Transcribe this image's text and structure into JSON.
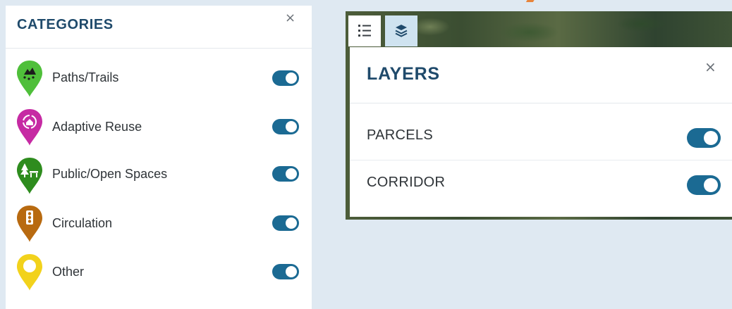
{
  "colors": {
    "accent": "#1f4a6b",
    "toggle_on": "#1b6a93",
    "background": "#dfe9f2",
    "pin_paths": "#4fbf3a",
    "pin_adaptive": "#c62aa3",
    "pin_public": "#2e8c1e",
    "pin_circulation": "#b86a10",
    "pin_other": "#f2d21c"
  },
  "categories": {
    "title": "CATEGORIES",
    "close_label": "×",
    "items": [
      {
        "label": "Paths/Trails",
        "icon": "hiking-trail-icon",
        "on": true
      },
      {
        "label": "Adaptive Reuse",
        "icon": "recycle-house-icon",
        "on": true
      },
      {
        "label": "Public/Open Spaces",
        "icon": "park-bench-tree-icon",
        "on": true
      },
      {
        "label": "Circulation",
        "icon": "traffic-light-icon",
        "on": true
      },
      {
        "label": "Other",
        "icon": "ring-icon",
        "on": true
      }
    ]
  },
  "map_tabs": [
    {
      "icon": "list-icon",
      "active": false
    },
    {
      "icon": "layers-icon",
      "active": true
    }
  ],
  "layers": {
    "title": "LAYERS",
    "close_label": "×",
    "items": [
      {
        "label": "PARCELS",
        "on": true
      },
      {
        "label": "CORRIDOR",
        "on": true
      }
    ]
  }
}
